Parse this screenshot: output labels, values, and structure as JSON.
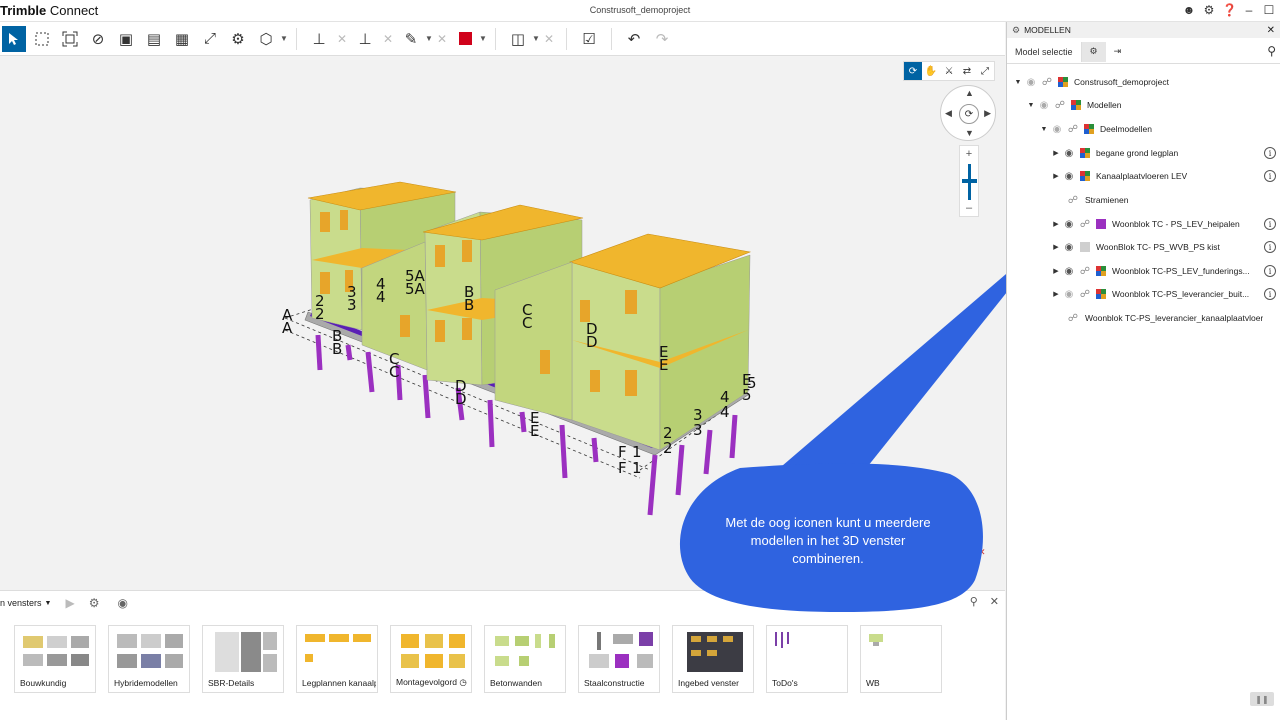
{
  "app": {
    "brand_bold": "Trimble",
    "brand_rest": " Connect",
    "project_title": "Construsoft_demoproject"
  },
  "window_controls": [
    "user-icon",
    "gear-icon",
    "help-icon",
    "minimize-icon",
    "maximize-icon"
  ],
  "toolbar": {
    "tools": [
      "select-icon",
      "box-select-icon",
      "fit-icon",
      "hide-icon",
      "view-icon",
      "section-icon",
      "clip-icon",
      "expand-icon",
      "object-icon",
      "cube-icon",
      "measure-icon",
      "level-icon",
      "pen-icon",
      "color-icon",
      "split-icon",
      "check-icon",
      "undo-icon",
      "redo-icon"
    ]
  },
  "viewport": {
    "labels": {
      "a": "A",
      "two": "2",
      "three": "3",
      "four": "4",
      "fiveA": "5A",
      "b": "B",
      "c": "C",
      "d": "D",
      "e": "E",
      "f": "F",
      "one": "1",
      "five": "5"
    }
  },
  "bubble": {
    "text": "Met de oog iconen kunt u meerdere modellen in het 3D venster combineren."
  },
  "bottom_panel": {
    "views_label": "n vensters",
    "cards": [
      {
        "label": "Bouwkundig"
      },
      {
        "label": "Hybridemodellen"
      },
      {
        "label": "SBR-Details"
      },
      {
        "label": "Legplannen kanaalp"
      },
      {
        "label": "Montagevolgord"
      },
      {
        "label": "Betonwanden"
      },
      {
        "label": "Staalconstructie"
      },
      {
        "label": "Ingebed venster"
      },
      {
        "label": "ToDo's"
      },
      {
        "label": "WB"
      }
    ]
  },
  "right_panel": {
    "header": "MODELLEN",
    "tabs": {
      "model_selection": "Model selectie"
    },
    "tree": [
      {
        "label": "Construsoft_demoproject",
        "depth": 0
      },
      {
        "label": "Modellen",
        "depth": 1
      },
      {
        "label": "Deelmodellen",
        "depth": 2
      },
      {
        "label": "begane grond legplan",
        "depth": 3
      },
      {
        "label": "Kanaalplaatvloeren LEV",
        "depth": 3
      },
      {
        "label": "Stramienen",
        "depth": 3
      },
      {
        "label": "Woonblok TC - PS_LEV_heipalen",
        "depth": 3
      },
      {
        "label": "WoonBlok TC- PS_WVB_PS kist",
        "depth": 3
      },
      {
        "label": "Woonblok TC-PS_LEV_funderings...",
        "depth": 3
      },
      {
        "label": "Woonblok TC-PS_leverancier_buit...",
        "depth": 3
      },
      {
        "label": "Woonblok TC-PS_leverancier_kanaalplaatvloer",
        "depth": 3
      }
    ]
  },
  "colors": {
    "accent": "#0063a3",
    "bubble": "#2f63e0",
    "wall": "#c9dc8c",
    "slab": "#f0b62d",
    "pile": "#9b30c0",
    "beam": "#5a1fb5"
  }
}
